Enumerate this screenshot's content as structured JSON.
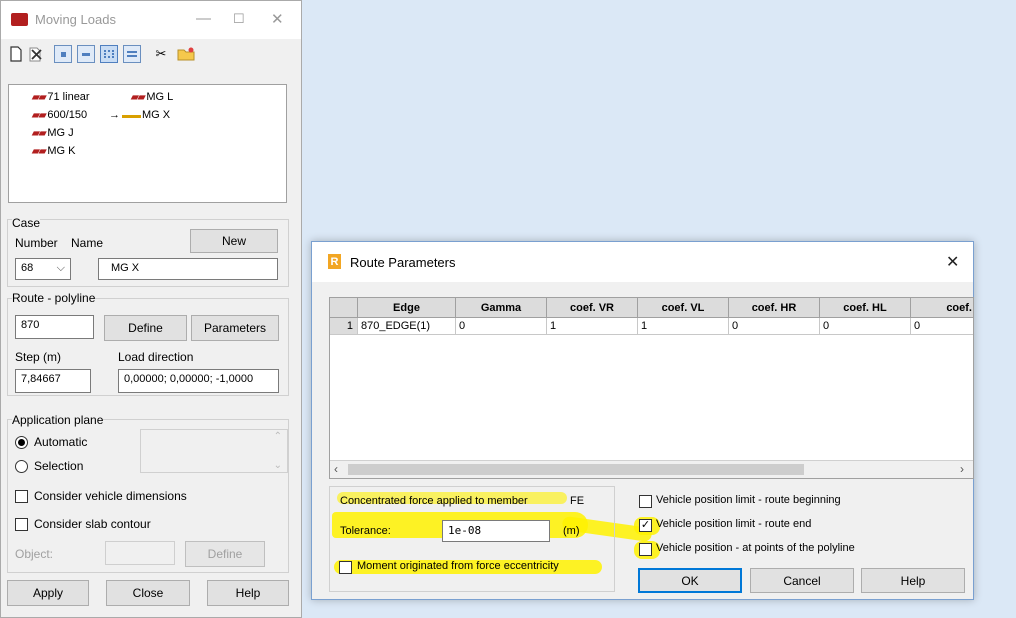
{
  "moving_loads": {
    "title": "Moving Loads",
    "window_controls": {
      "minimize": "—",
      "maximize": "☐",
      "close": "✕"
    },
    "toolbar_icons": [
      "new-icon",
      "delete-icon",
      "view-small-icon",
      "view-list-icon",
      "view-details-icon",
      "view-table-icon",
      "cut-icon",
      "open-folder-icon"
    ],
    "vehicles": [
      {
        "label": "71 linear"
      },
      {
        "label": "600/150"
      },
      {
        "label": "MG J"
      },
      {
        "label": "MG K"
      },
      {
        "label": "MG L"
      },
      {
        "label": "MG X",
        "current": true
      }
    ],
    "case": {
      "group_label": "Case",
      "number_label": "Number",
      "name_label": "Name",
      "new_label": "New",
      "number_value": "68",
      "name_value": "MG X"
    },
    "route": {
      "group_label": "Route - polyline",
      "value": "870",
      "define_label": "Define",
      "parameters_label": "Parameters",
      "step_label": "Step (m)",
      "step_value": "7,84667",
      "direction_label": "Load direction",
      "direction_value": "0,00000; 0,00000; -1,0000"
    },
    "plane": {
      "group_label": "Application plane",
      "automatic_label": "Automatic",
      "selection_label": "Selection",
      "automatic_selected": true
    },
    "consider_dimensions_label": "Consider vehicle dimensions",
    "consider_slab_label": "Consider slab contour",
    "object_label": "Object:",
    "object_define_label": "Define",
    "buttons": {
      "apply": "Apply",
      "close": "Close",
      "help": "Help"
    }
  },
  "route_parameters": {
    "title": "Route Parameters",
    "logo": "R",
    "close": "✕",
    "columns": [
      "",
      "Edge",
      "Gamma",
      "coef. VR",
      "coef. VL",
      "coef. HR",
      "coef. HL",
      "coef."
    ],
    "rows": [
      [
        "1",
        "870_EDGE(1)",
        "0",
        "1",
        "1",
        "0",
        "0",
        "0"
      ]
    ],
    "force_label": "Concentrated force applied to member",
    "force_suffix": "FE",
    "tolerance_label": "Tolerance:",
    "tolerance_value": "1e-08",
    "tolerance_unit": "(m)",
    "moment_label": "Moment originated from force eccentricity",
    "moment_checked": false,
    "limit_beginning_label": "Vehicle position limit - route beginning",
    "limit_beginning_checked": false,
    "limit_end_label": "Vehicle position limit - route end",
    "limit_end_checked": true,
    "at_points_label": "Vehicle position - at points of the polyline",
    "at_points_checked": false,
    "buttons": {
      "ok": "OK",
      "cancel": "Cancel",
      "help": "Help"
    }
  },
  "colors": {
    "highlight": "#fff200",
    "truck_red": "#b21f1f",
    "selection_blue": "#0078d7"
  }
}
